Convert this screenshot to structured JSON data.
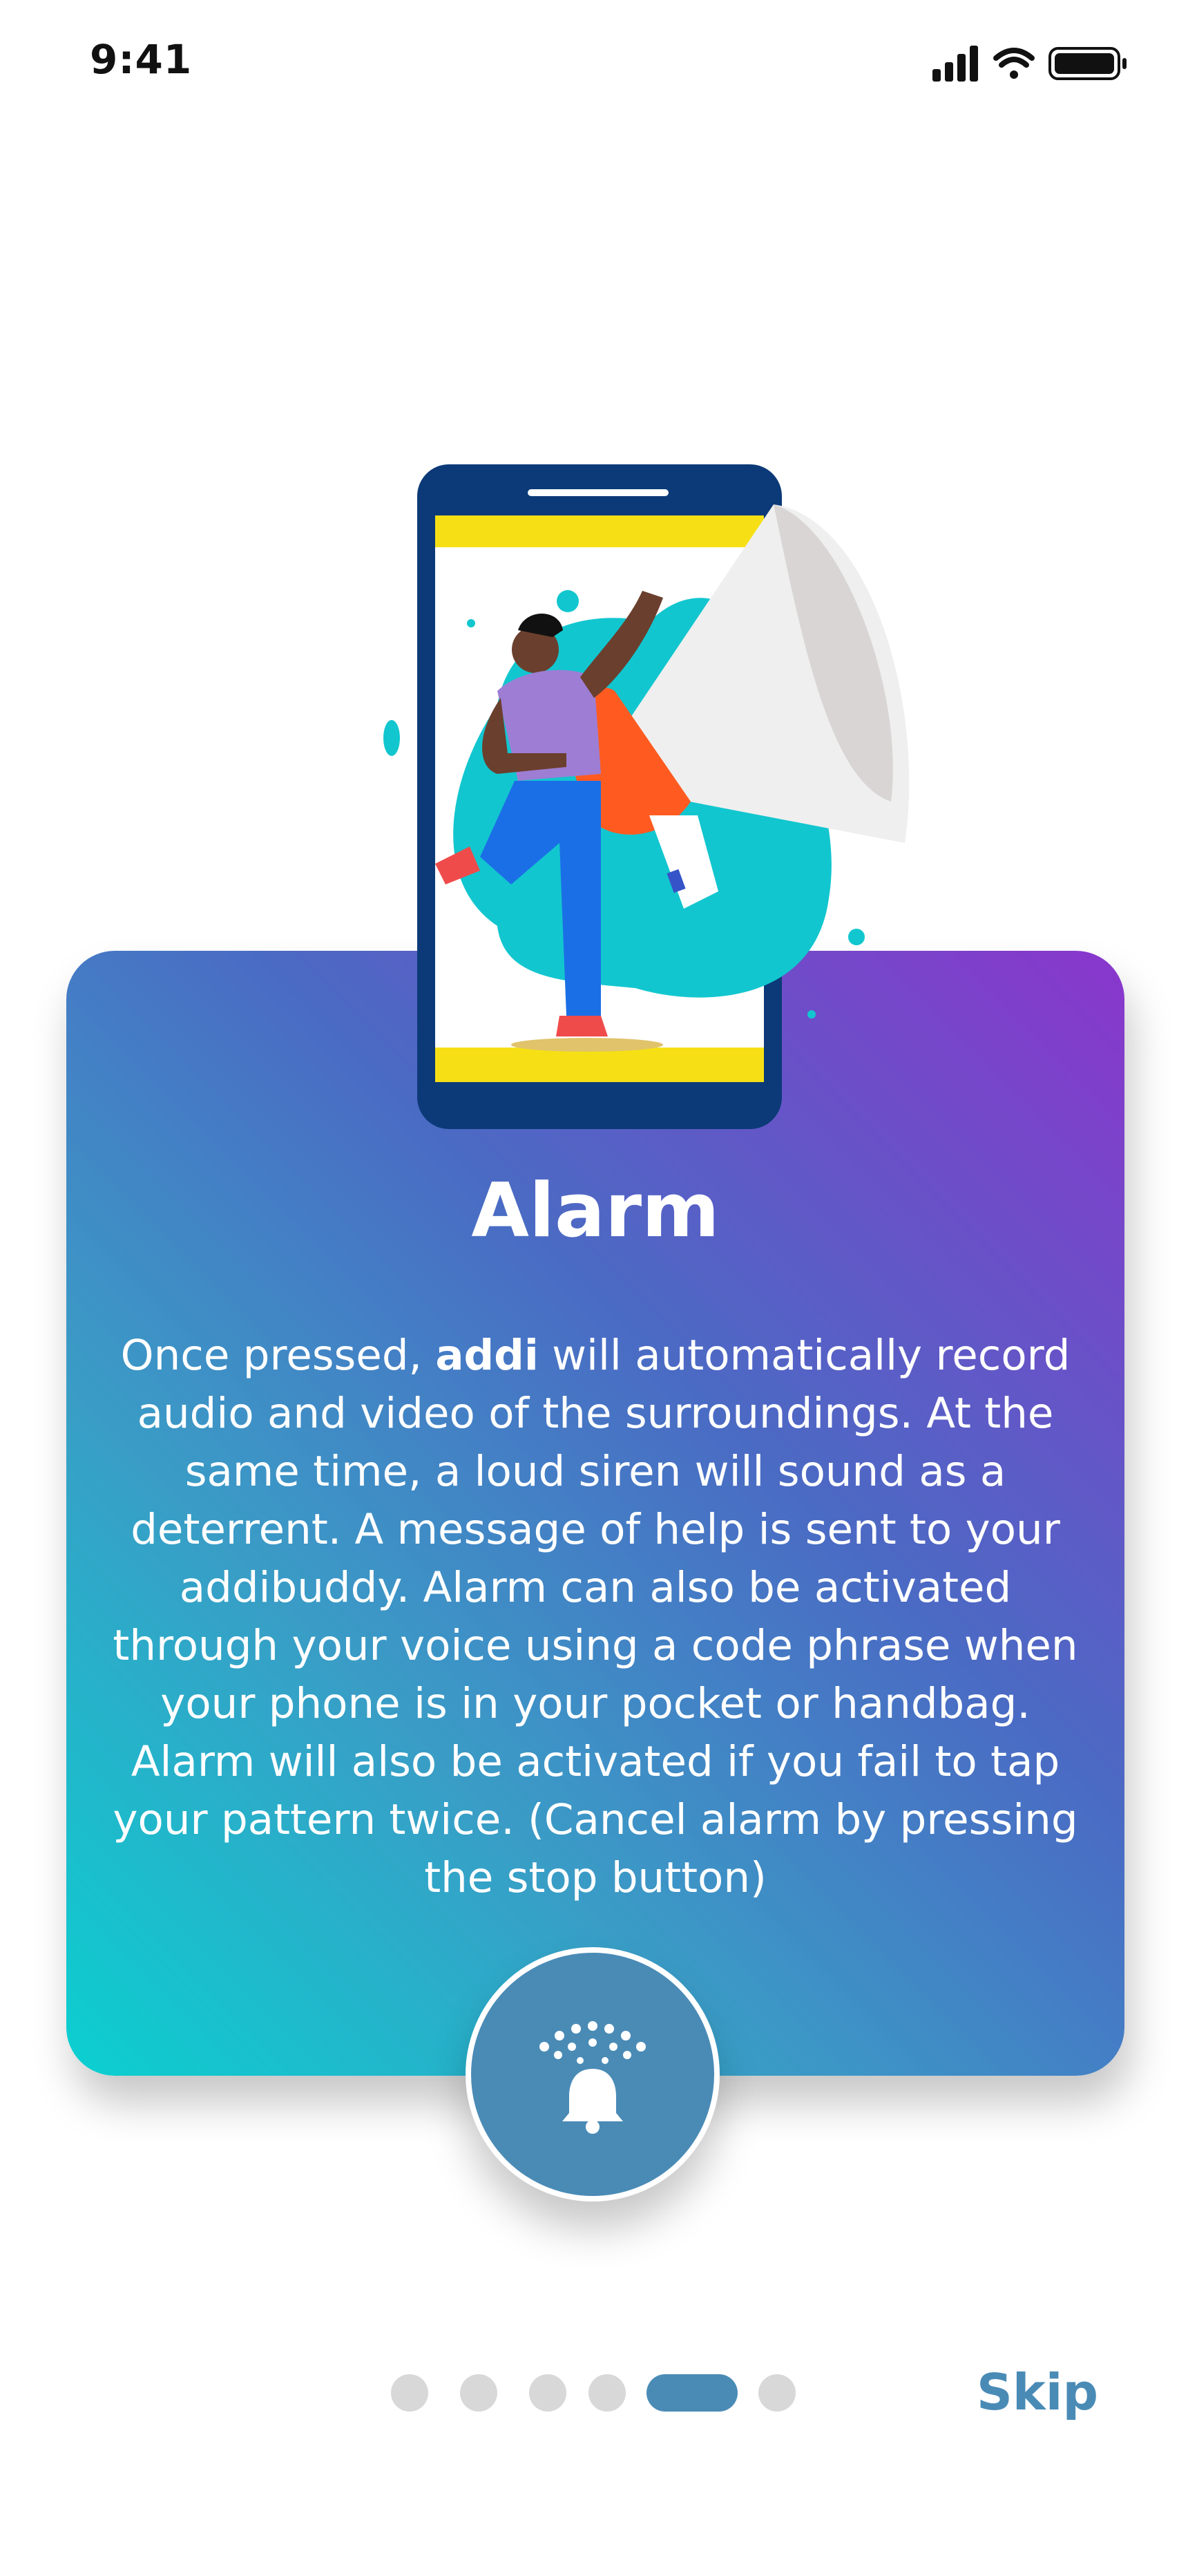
{
  "status_bar": {
    "time": "9:41"
  },
  "onboarding": {
    "title": "Alarm",
    "description_prefix": "Once pressed, ",
    "brand_word": "addi",
    "description_suffix": " will automatically record audio and video of the surroundings. At the same time, a loud siren will sound as a deterrent. A message of help is sent to your addibuddy. Alarm can also be activated through your voice using a code phrase when your phone is in your pocket or handbag. Alarm will also be activated if you fail to tap your pattern twice. (Cancel alarm by pressing the stop button)",
    "icon": "bell-alarm-icon",
    "illustration": "person-with-megaphone-on-phone"
  },
  "pager": {
    "total": 6,
    "active_index": 4
  },
  "skip_label": "Skip",
  "colors": {
    "accent": "#4a8bb6",
    "gradient_start": "#0ad0d0",
    "gradient_end": "#8a36cc",
    "dot_inactive": "#d8d8d8"
  }
}
